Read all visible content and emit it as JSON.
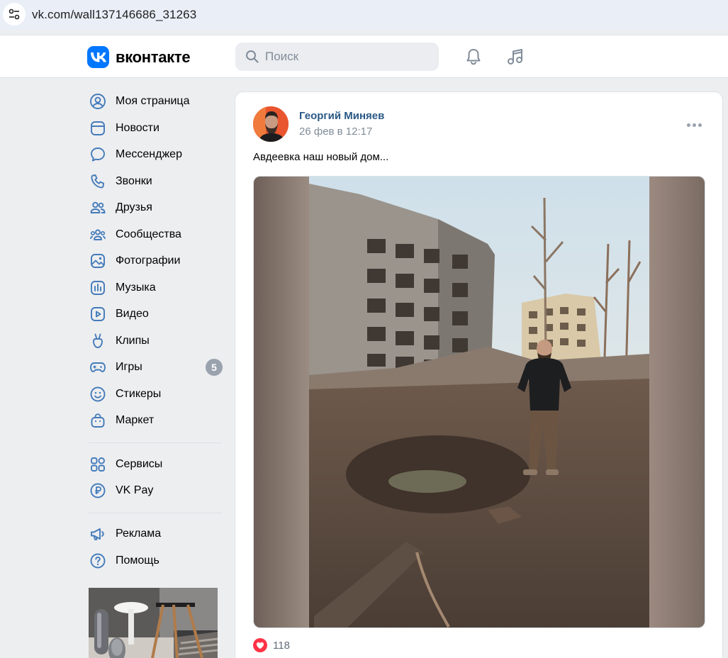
{
  "browser": {
    "url": "vk.com/wall137146686_31263"
  },
  "header": {
    "logo_text": "вконтакте",
    "search_placeholder": "Поиск"
  },
  "sidebar": {
    "items": [
      {
        "label": "Моя страница",
        "icon": "user-circle-icon"
      },
      {
        "label": "Новости",
        "icon": "newsfeed-icon"
      },
      {
        "label": "Мессенджер",
        "icon": "message-icon"
      },
      {
        "label": "Звонки",
        "icon": "phone-icon"
      },
      {
        "label": "Друзья",
        "icon": "friends-icon"
      },
      {
        "label": "Сообщества",
        "icon": "communities-icon"
      },
      {
        "label": "Фотографии",
        "icon": "photos-icon"
      },
      {
        "label": "Музыка",
        "icon": "music-icon"
      },
      {
        "label": "Видео",
        "icon": "video-icon"
      },
      {
        "label": "Клипы",
        "icon": "clips-icon"
      },
      {
        "label": "Игры",
        "icon": "games-icon",
        "badge": "5"
      },
      {
        "label": "Стикеры",
        "icon": "stickers-icon"
      },
      {
        "label": "Маркет",
        "icon": "market-icon"
      },
      {
        "label": "Сервисы",
        "icon": "services-icon"
      },
      {
        "label": "VK Pay",
        "icon": "vkpay-icon"
      },
      {
        "label": "Реклама",
        "icon": "megaphone-icon"
      },
      {
        "label": "Помощь",
        "icon": "help-icon"
      }
    ]
  },
  "post": {
    "author": "Георгий Миняев",
    "date": "26 фев в 12:17",
    "text": "Авдеевка наш новый дом...",
    "likes": "118"
  },
  "colors": {
    "accent": "#0077ff",
    "link": "#2a5885",
    "icon": "#447bba",
    "like": "#ff3347"
  }
}
